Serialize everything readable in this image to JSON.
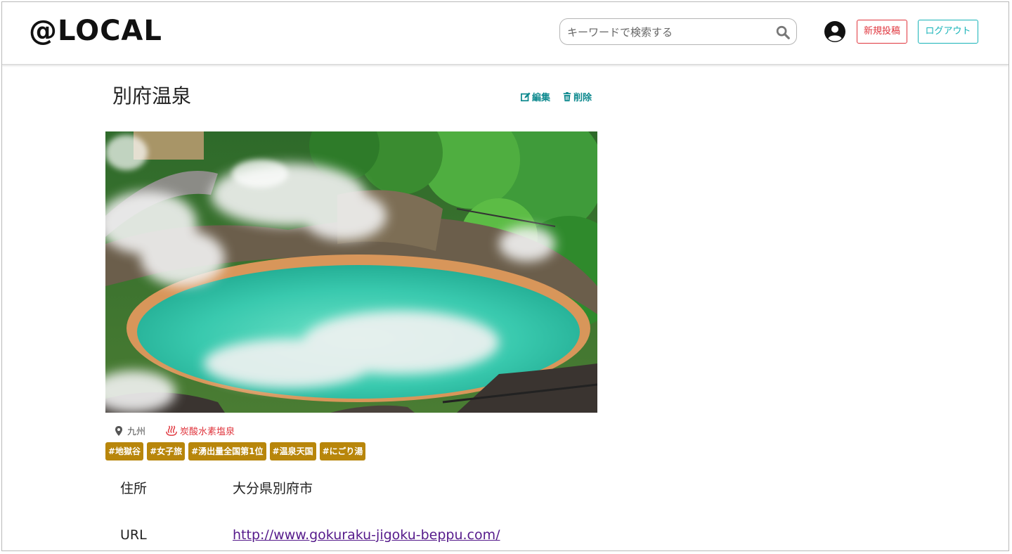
{
  "header": {
    "logo": "@LOCAL",
    "search_placeholder": "キーワードで検索する",
    "new_post_label": "新規投稿",
    "logout_label": "ログアウト"
  },
  "post": {
    "title": "別府温泉",
    "edit_label": "編集",
    "delete_label": "削除",
    "region": "九州",
    "spring_type": "炭酸水素塩泉",
    "tags": [
      "#地獄谷",
      "#女子旅",
      "#湧出量全国第1位",
      "#温泉天国",
      "#にごり湯"
    ],
    "details": [
      {
        "label": "住所",
        "value": "大分県別府市"
      },
      {
        "label": "URL",
        "value": "http://www.gokuraku-jigoku-beppu.com/"
      }
    ]
  },
  "colors": {
    "new_post": "#e0353d",
    "logout": "#17b3b8",
    "action": "#0f8a8f",
    "tag_bg": "#b8860b",
    "link": "#551a8b"
  },
  "icons": [
    "search-icon",
    "user-circle-icon",
    "edit-icon",
    "trash-icon",
    "map-pin-icon",
    "hot-spring-icon"
  ]
}
